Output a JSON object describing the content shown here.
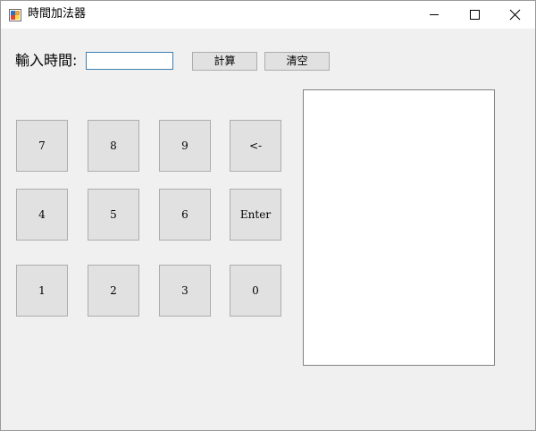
{
  "window": {
    "title": "時間加法器",
    "controls": {
      "minimize": "minimize-icon",
      "maximize": "maximize-icon",
      "close": "close-icon"
    }
  },
  "form": {
    "input_label": "輸入時間:",
    "input_value": "",
    "calc_button": "計算",
    "clear_button": "清空"
  },
  "keypad": {
    "keys": [
      "7",
      "8",
      "9",
      "<-",
      "4",
      "5",
      "6",
      "Enter",
      "1",
      "2",
      "3",
      "0"
    ]
  },
  "output": {
    "text": ""
  },
  "colors": {
    "window_bg": "#f0f0f0",
    "titlebar_bg": "#ffffff",
    "button_bg": "#e1e1e1",
    "button_border": "#adadad",
    "input_border": "#3c7fb1"
  }
}
